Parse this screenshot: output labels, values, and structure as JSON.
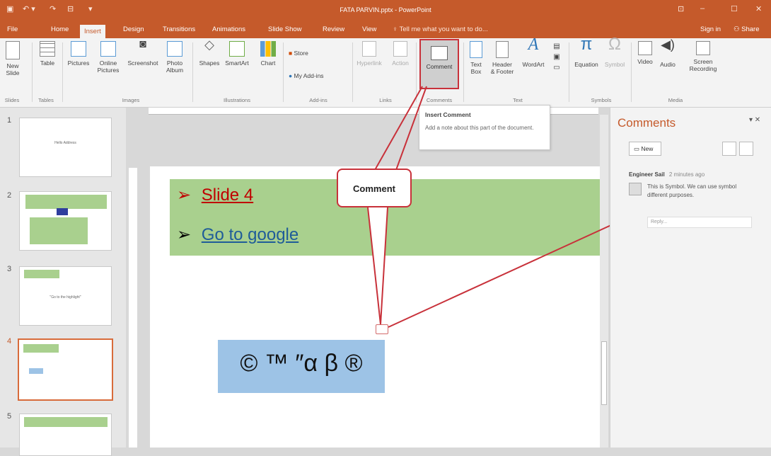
{
  "window": {
    "title": "FATA PARVIN.pptx - PowerPoint",
    "tell_me": "Tell me what you want to do...",
    "sign_in": "Sign in",
    "share": "Share"
  },
  "tabs": [
    "File",
    "Home",
    "Insert",
    "Design",
    "Transitions",
    "Animations",
    "Slide Show",
    "Review",
    "View"
  ],
  "active_tab": "Insert",
  "ribbon": {
    "new_slide": "New\nSlide",
    "table": "Table",
    "pictures": "Pictures",
    "online_pictures": "Online\nPictures",
    "screenshot": "Screenshot",
    "photo_album": "Photo\nAlbum",
    "shapes": "Shapes",
    "smartart": "SmartArt",
    "chart": "Chart",
    "store": "Store",
    "my_addins": "My Add-ins",
    "hyperlink": "Hyperlink",
    "action": "Action",
    "comment": "Comment",
    "text_box": "Text\nBox",
    "header_footer": "Header\n& Footer",
    "wordart": "WordArt",
    "equation": "Equation",
    "symbol": "Symbol",
    "video": "Video",
    "audio": "Audio",
    "screen_recording": "Screen\nRecording",
    "groups": {
      "slides": "Slides",
      "tables": "Tables",
      "images": "Images",
      "illustrations": "Illustrations",
      "addins": "Add-ins",
      "links": "Links",
      "comments": "Comments",
      "text": "Text",
      "symbols": "Symbols",
      "media": "Media"
    }
  },
  "tooltip": {
    "title": "Insert Comment",
    "body": "Add a note about this part of the document."
  },
  "slides": [
    "1",
    "2",
    "3",
    "4",
    "5"
  ],
  "thumb_texts": {
    "s1": "Hello Address",
    "s3": "\"Go to the highlight\""
  },
  "slide": {
    "bullet1": "Slide 4",
    "bullet2": "Go to google",
    "symbols": "© ™ ″α β ®"
  },
  "callout": "Comment",
  "comments": {
    "header": "Comments",
    "new_button": "New",
    "author": "Engineer Sail",
    "time": "2 minutes ago",
    "text": "This is Symbol. We can use symbol different purposes.",
    "reply_placeholder": "Reply..."
  }
}
